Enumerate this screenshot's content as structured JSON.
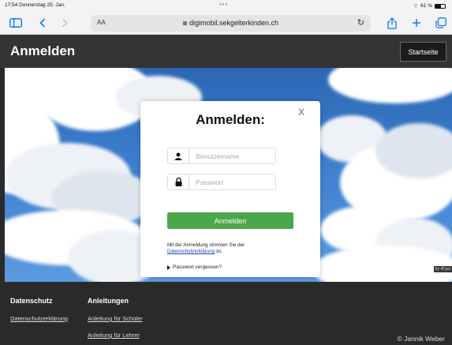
{
  "status_bar": {
    "time_date": "17:54  Donnerstag 25. Jan.",
    "dots": "•••",
    "wifi_symbol": "⌔",
    "battery_text": "61 %",
    "battery_level": 0.61
  },
  "browser": {
    "text_size_label": "AA",
    "url": "digimobil.sekgelterkinden.ch",
    "accent_color": "#0a7aff"
  },
  "header": {
    "title": "Anmelden",
    "home_button": "Startseite"
  },
  "hero": {
    "credit": "by 4Cycl"
  },
  "login": {
    "close": "X",
    "title": "Anmelden:",
    "username_placeholder": "Benutzername",
    "password_placeholder": "Passwort",
    "submit": "Anmelden",
    "submit_color": "#4ca64c",
    "consent_text": "Mit der Anmeldung stimmen Sie der",
    "consent_link": "Datenschutzerklärung",
    "consent_suffix": " zu.",
    "forgot": "Passwort vergessen?"
  },
  "footer": {
    "col1_title": "Datenschutz",
    "col1_link": "Datenschutzerklärung",
    "col2_title": "Anleitungen",
    "col2_links": [
      "Anleitung für Schüler",
      "Anleitung für Lehrer"
    ],
    "copyright": "© Jannik Weber"
  }
}
